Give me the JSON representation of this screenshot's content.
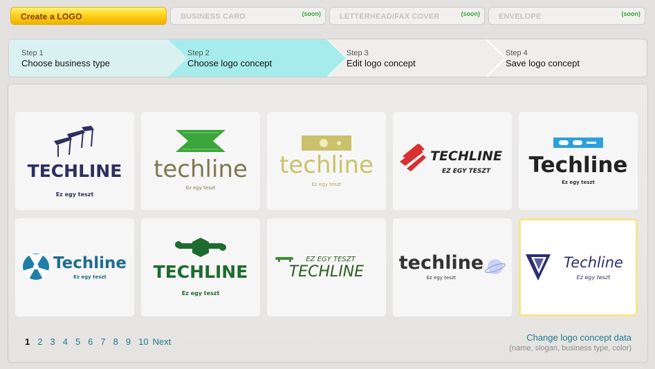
{
  "tabs": [
    {
      "label": "Create a LOGO",
      "soon": "",
      "active": true
    },
    {
      "label": "BUSINESS CARD",
      "soon": "(soon)"
    },
    {
      "label": "LETTERHEAD/FAX COVER",
      "soon": "(soon)"
    },
    {
      "label": "ENVELOPE",
      "soon": "(soon)"
    }
  ],
  "steps": [
    {
      "num": "Step 1",
      "name": "Choose business type"
    },
    {
      "num": "Step 2",
      "name": "Choose logo concept"
    },
    {
      "num": "Step 3",
      "name": "Edit logo concept"
    },
    {
      "num": "Step 4",
      "name": "Save logo concept"
    }
  ],
  "colors": {
    "step_done": "#daf1f2",
    "step_active": "#a7ecec",
    "link": "#1e7a8c"
  },
  "logos": [
    {
      "name": "TECHLINE",
      "slogan": "Ez egy teszt"
    },
    {
      "name": "techline",
      "slogan": "Ez egy teszt"
    },
    {
      "name": "techline",
      "slogan": "Ez egy teszt"
    },
    {
      "name": "TECHLINE",
      "slogan": "EZ EGY TESZT"
    },
    {
      "name": "Techline",
      "slogan": "Ez egy teszt"
    },
    {
      "name": "Techline",
      "slogan": "Ez egy teszt"
    },
    {
      "name": "TECHLINE",
      "slogan": "Ez egy teszt"
    },
    {
      "name": "TECHLINE",
      "slogan": "EZ EGY TESZT"
    },
    {
      "name": "techline",
      "slogan": "Ez egy teszt"
    },
    {
      "name": "Techline",
      "slogan": "Ez egy teszt"
    }
  ],
  "selected_logo_index": 9,
  "pagination": {
    "pages": [
      "1",
      "2",
      "3",
      "4",
      "5",
      "6",
      "7",
      "8",
      "9",
      "10"
    ],
    "next": "Next",
    "current": "1"
  },
  "change_link": "Change logo concept data",
  "change_hint": "(name, slogan, business type, color)"
}
